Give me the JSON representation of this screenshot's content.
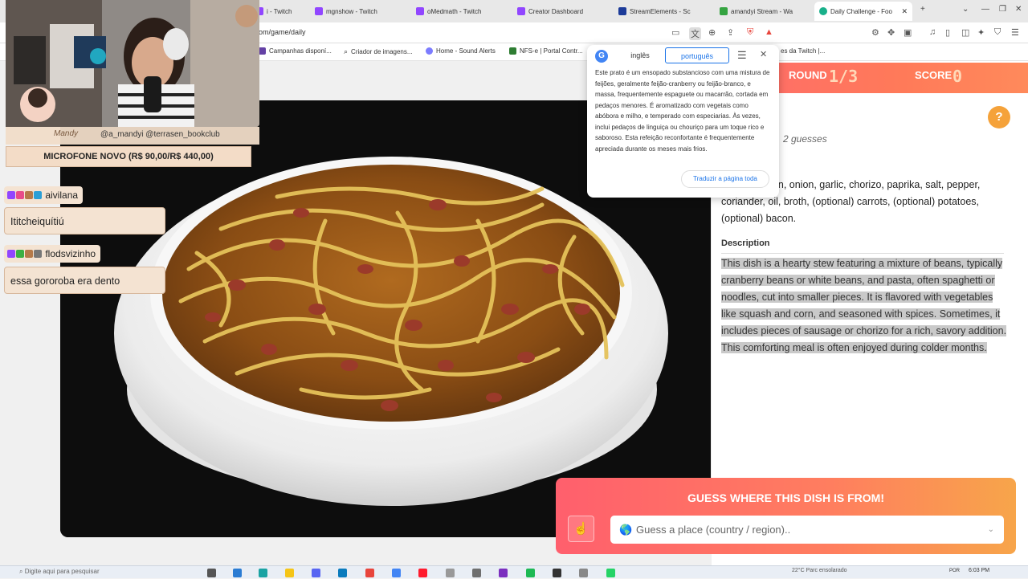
{
  "tabs": [
    {
      "title": "i - Twitch",
      "color": "#9146ff"
    },
    {
      "title": "mgnshow - Twitch",
      "color": "#9146ff"
    },
    {
      "title": "oMedmath - Twitch",
      "color": "#9146ff"
    },
    {
      "title": "Creator Dashboard",
      "color": "#9146ff"
    },
    {
      "title": "StreamElements - Sc",
      "color": "#1c3b99"
    },
    {
      "title": "amandyi Stream - Wa",
      "color": "#35a441"
    },
    {
      "title": "Daily Challenge - Foo",
      "color": "#19b08a"
    }
  ],
  "address": {
    "url": "om/game/daily"
  },
  "bookmarks": [
    {
      "label": "Campanhas disponí...",
      "color": "#6441a5"
    },
    {
      "label": "Criador de imagens...",
      "color": "#888"
    },
    {
      "label": "Home - Sound Alerts",
      "color": "#7c7cff"
    },
    {
      "label": "NFS-e | Portal Contr...",
      "color": "#2e7d32"
    },
    {
      "label": "es da Twitch |...",
      "color": "#9146ff"
    }
  ],
  "game": {
    "round_label": "ROUND",
    "round_value": "1/3",
    "score_label": "SCORE",
    "score_value": "0",
    "help": "?",
    "guesses": "2 guesses",
    "ingredients": "netti, pumpkin, onion, garlic, chorizo, paprika, salt, pepper, coriander, oil, broth, (optional) carrots, (optional) potatoes, (optional) bacon.",
    "description_title": "Description",
    "description": "This dish is a hearty stew featuring a mixture of beans, typically cranberry beans or white beans, and pasta, often spaghetti or noodles, cut into smaller pieces. It is flavored with vegetables like squash and corn, and seasoned with spices. Sometimes, it includes pieces of sausage or chorizo for a rich, savory addition. This comforting meal is often enjoyed during colder months."
  },
  "translate": {
    "lang_from": "inglês",
    "lang_to": "português",
    "text": "Este prato é um ensopado substancioso com uma mistura de feijões, geralmente feijão-cranberry ou feijão-branco, e massa, frequentemente espaguete ou macarrão, cortada em pedaços menores. É aromatizado com vegetais como abóbora e milho, e temperado com especiarias. Às vezes, inclui pedaços de linguiça ou chouriço para um toque rico e saboroso. Esta refeição reconfortante é frequentemente apreciada durante os meses mais frios.",
    "button": "Traduzir a página toda"
  },
  "guess": {
    "title": "GUESS WHERE THIS DISH IS FROM!",
    "placeholder": "Guess a place (country / region)..",
    "icon": "hand-pointer-icon"
  },
  "overlay": {
    "socials": "@a_mandyi  @terrasen_bookclub",
    "mic_banner": "MICROFONE NOVO (R$ 90,00/R$ 440,00)",
    "chat": [
      {
        "name": "aivilana",
        "message": "Ititcheiquítiú"
      },
      {
        "name": "flodsvizinho",
        "message": "essa gororoba era dento"
      }
    ]
  },
  "taskbar": {
    "search_placeholder": "Digite aqui para pesquisar",
    "weather": "22°C  Parc ensolarado",
    "lang": "POR",
    "time": "6:03 PM"
  }
}
